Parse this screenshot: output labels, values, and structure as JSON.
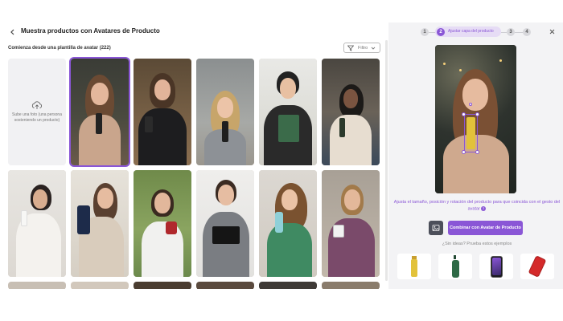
{
  "header": {
    "title": "Muestra productos con Avatares de Producto",
    "subtitle": "Comienza desde una plantilla de avatar (222)",
    "filter_label": "Filtro"
  },
  "upload": {
    "label": "Sube una foto (una persona sosteniendo un producto)"
  },
  "steps": {
    "items": [
      "1",
      "2",
      "3",
      "4"
    ],
    "active_label": "Ajustar capa del producto"
  },
  "editor": {
    "hint": "Ajusta el tamaño, posición y rotación del producto para que coincida con el gesto del avatar",
    "combine_label": "Combinar con Avatar de Producto",
    "ideas_label": "¿Sin ideas? Prueba estos ejemplos"
  },
  "colors": {
    "accent": "#8a56d6",
    "panel_bg": "#f3f3f5"
  },
  "icons": {
    "back": "chevron-left-icon",
    "filter": "filter-icon",
    "upload": "cloud-upload-icon",
    "close": "close-icon",
    "image": "image-icon",
    "help": "help-icon"
  },
  "examples": [
    "gold-bottle",
    "green-bottle",
    "smartphone",
    "soda-can"
  ]
}
